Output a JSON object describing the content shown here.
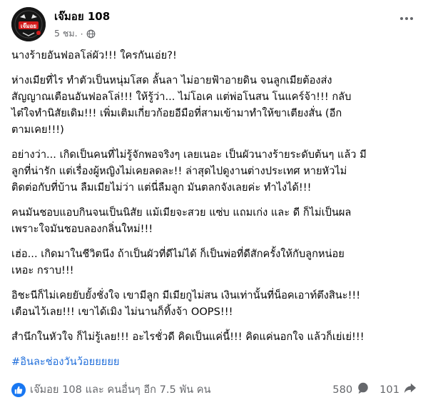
{
  "post": {
    "author": "เจ๊มอย 108",
    "time": "5 ชม.",
    "dot": "·",
    "avatar_icon": "page-avatar-logo",
    "avatar_text": "เจ๊มอย"
  },
  "content": {
    "p1": [
      "นางร้ายอันฟอลโล่ผัว!!! ใครกันเอ่ย?!"
    ],
    "p2": [
      "ห่างเมียที่ไร ทำตัวเป็นหนุ่มโสด ลั้นลา ไม่อายฟ้าอายดิน จนลูกเมียต้องส่ง",
      "สัญญาณเตือนอันฟอลโล่!!! ให้รู้ว่า... ไม่โอเค แต่พ่อโนสน โนแคร์จ้า!!! กลับ",
      "ไต๋ใจทำนิสัยเดิม!!! เพิ่มเติมเกี่ยวก้อยอีมือที่สามเข้ามาทำให้ขาเตียงสั่น (อีก",
      "ตามเคย!!!)"
    ],
    "p3": [
      "อย่างว่า... เกิดเป็นคนที่ไม่รู้จักพอจริงๆ เลยเนอะ เป็นผัวนางร้ายระดับต้นๆ แล้ว มี",
      "ลูกที่น่ารัก แต่เรื่องผู้หญิงไม่เคยลดละ!! ล่าสุดไปดูงานต่างประเทศ หายหัวไม่",
      "ติดต่อกับที่บ้าน ลืมเมียไม่ว่า แต่นี่ลืมลูก มันตลกจังเลยค่ะ ทำไงได้!!!"
    ],
    "p4": [
      "คนมันชอบแอบกินจนเป็นนิสัย แม้เมียจะสวย แซ่บ แถมเก่ง และ ดี ก็ไม่เป็นผล",
      "เพราะใจมันชอบลองกลิ่นใหม่!!!"
    ],
    "p5": [
      "เฮ่อ... เกิดมาในชีวิตนึง ถ้าเป็นผัวที่ดีไม่ได้ ก็เป็นพ่อที่ดีสักครั้งให้กับลูกหน่อย",
      "เหอะ กราบ!!!"
    ],
    "p6": [
      "อิชะนีก็ไม่เคยยับยั้งชั่งใจ เขามีลูก มีเมียกูไม่สน เงินเท่านั้นที่น็อคเอาท์ตึงสินะ!!!",
      "เตือนไว้เลย!!! เขาได้เมิง ไม่นานก็ทิ้งจ้า OOPS!!!"
    ],
    "p7": [
      "สำนึกในหัวใจ ก็ไม่รู้เลย!!! อะไรชั่วดี คิดเป็นแค่นี้!!! คิดแค่นอกใจ แล้วก็เย่เย่!!!"
    ],
    "hashtag": "#อินละช่องวันว้อยยยยย"
  },
  "footer": {
    "reactions_text": "เจ๊มอย 108 และ คนอื่นๆ อีก 7.5 พัน คน",
    "comments": "580",
    "shares": "101"
  },
  "colors": {
    "text": "#050505",
    "meta": "#65676b",
    "link": "#216fdb",
    "like": "#1877f2"
  }
}
